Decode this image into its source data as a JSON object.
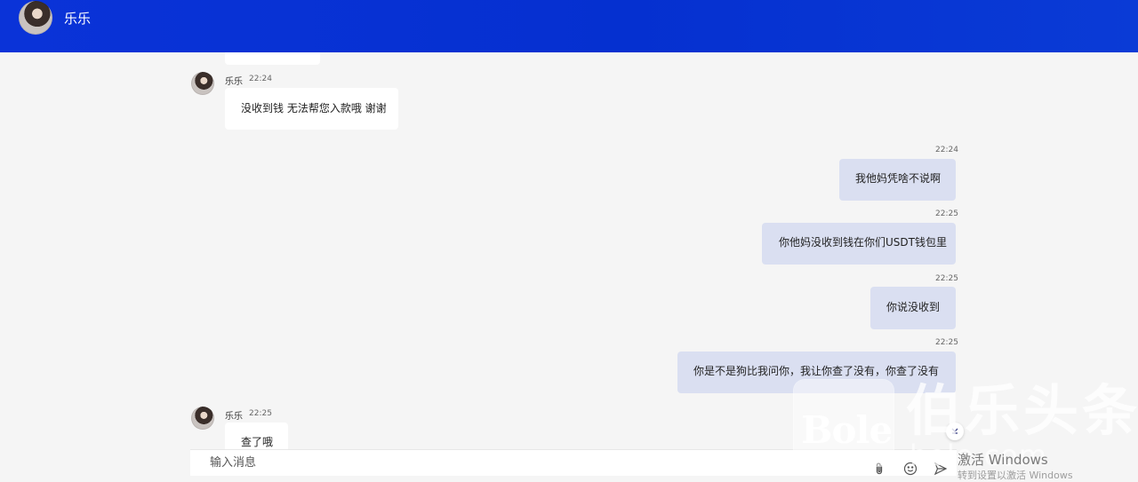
{
  "header": {
    "title": "乐乐"
  },
  "messages": [
    {
      "direction": "in",
      "sender": "乐乐",
      "time": "22:24",
      "text": "没收到钱 无法帮您入款哦 谢谢"
    },
    {
      "direction": "out",
      "time": "22:24",
      "text": "我他妈凭啥不说啊"
    },
    {
      "direction": "out",
      "time": "22:25",
      "text": "你他妈没收到钱在你们USDT钱包里"
    },
    {
      "direction": "out",
      "time": "22:25",
      "text": "你说没收到"
    },
    {
      "direction": "out",
      "time": "22:25",
      "text": "你是不是狗比我问你，我让你查了没有，你查了没有"
    },
    {
      "direction": "in",
      "sender": "乐乐",
      "time": "22:25",
      "text": "查了哦"
    }
  ],
  "composer": {
    "placeholder": "输入消息"
  },
  "icons": {
    "attach": "paperclip-icon",
    "emoji": "emoji-icon",
    "send": "send-icon",
    "scroll_down": "chevron-down-icon"
  },
  "colors": {
    "header_bg": "#0530d0",
    "incoming_bubble": "#ffffff",
    "outgoing_bubble": "#dadff1",
    "page_bg": "#f5f5f5"
  },
  "watermark": {
    "logo": "Bole",
    "brand": "伯乐头条",
    "url": "bole.com"
  },
  "os_overlay": {
    "line1": "激活 Windows",
    "line2": "转到设置以激活 Windows"
  }
}
